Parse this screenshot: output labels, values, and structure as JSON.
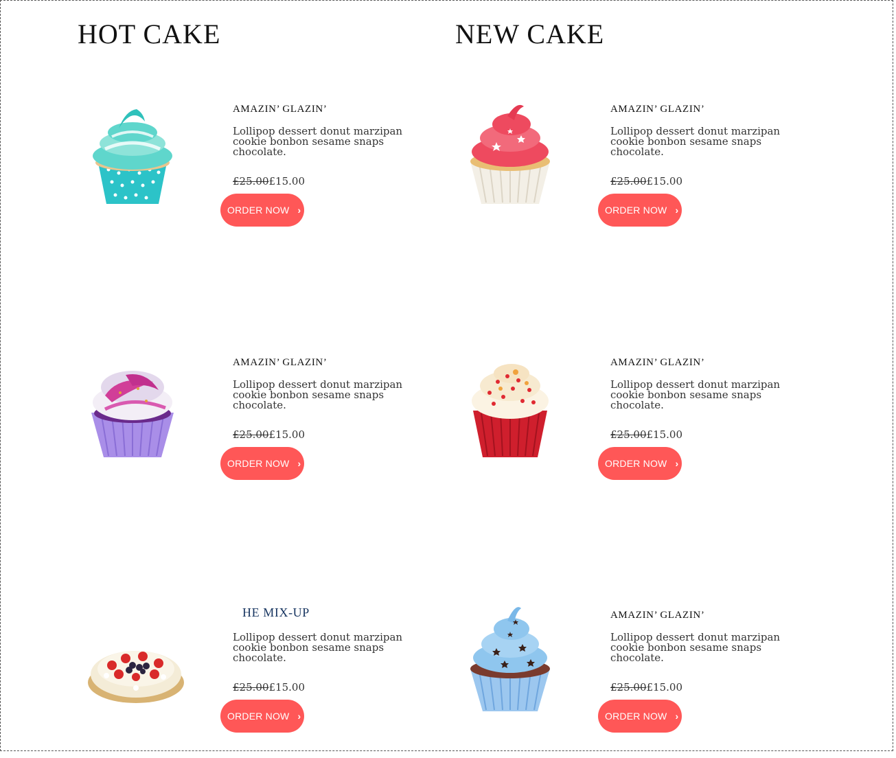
{
  "hot_cake": {
    "title": "HOT CAKE",
    "items": [
      {
        "name": "AMAZIN’ GLAZIN’",
        "description": "Lollipop dessert donut marzipan cookie bonbon sesame snaps chocolate.",
        "old_price": "£25.00",
        "price": "£15.00",
        "button": "ORDER NOW",
        "image": "teal-cupcake-image"
      },
      {
        "name": "AMAZIN’ GLAZIN’",
        "description": "Lollipop dessert donut marzipan cookie bonbon sesame snaps chocolate.",
        "old_price": "£25.00",
        "price": "£15.00",
        "button": "ORDER NOW",
        "image": "purple-sprinkle-cupcake-image"
      },
      {
        "name": "HE MIX-UP",
        "description": "Lollipop dessert donut marzipan cookie bonbon sesame snaps chocolate.",
        "old_price": "£25.00",
        "price": "£15.00",
        "button": "ORDER NOW",
        "image": "berry-tart-image"
      }
    ]
  },
  "new_cake": {
    "title": "NEW CAKE",
    "items": [
      {
        "name": "AMAZIN’ GLAZIN’",
        "description": "Lollipop dessert donut marzipan cookie bonbon sesame snaps chocolate.",
        "old_price": "£25.00",
        "price": "£15.00",
        "button": "ORDER NOW",
        "image": "pink-star-cupcake-image"
      },
      {
        "name": "AMAZIN’ GLAZIN’",
        "description": "Lollipop dessert donut marzipan cookie bonbon sesame snaps chocolate.",
        "old_price": "£25.00",
        "price": "£15.00",
        "button": "ORDER NOW",
        "image": "red-velvet-cupcake-image"
      },
      {
        "name": "AMAZIN’ GLAZIN’",
        "description": "Lollipop dessert donut marzipan cookie bonbon sesame snaps chocolate.",
        "old_price": "£25.00",
        "price": "£15.00",
        "button": "ORDER NOW",
        "image": "blue-star-cupcake-image"
      }
    ]
  },
  "icons": {
    "button_arrow": "chevron-right-icon"
  },
  "colors": {
    "button": "#ff5757",
    "text": "#333333",
    "alt_name": "#15335f"
  }
}
